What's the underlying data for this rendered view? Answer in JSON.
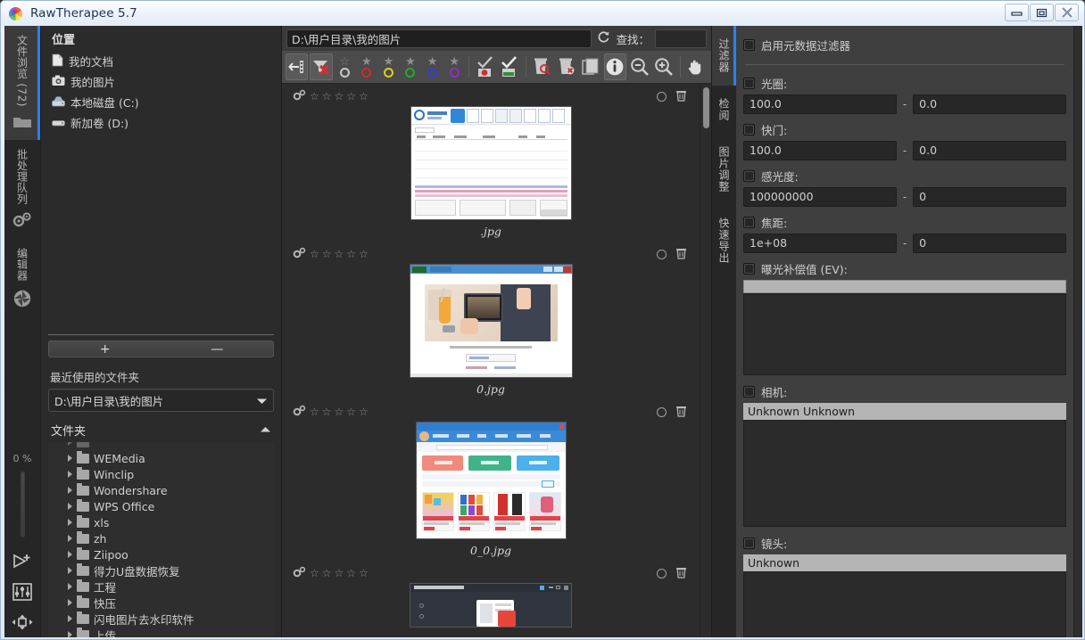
{
  "window": {
    "title": "RawTherapee 5.7",
    "logo_icon": "rawtherapee-color-wheel-icon",
    "buttons": {
      "minimize": "minimize-icon",
      "maximize": "restore-icon",
      "close": "close-icon"
    }
  },
  "left_tabs": [
    {
      "label": "文件浏览 (72)",
      "icon": "folder-icon",
      "active": true
    },
    {
      "label": "批处理队列",
      "icon": "gears-icon",
      "active": false
    },
    {
      "label": "编辑器",
      "icon": "aperture-icon",
      "active": false
    }
  ],
  "left_bottom": {
    "progress_percent": "0 %",
    "icons": [
      "send-to-editor-icon",
      "sliders-icon",
      "move-resize-icon"
    ]
  },
  "places": {
    "title": "位置",
    "items": [
      {
        "label": "我的文档",
        "icon": "document-icon"
      },
      {
        "label": "我的图片",
        "icon": "camera-icon"
      },
      {
        "label": "本地磁盘 (C:)",
        "icon": "hard-disk-icon"
      },
      {
        "label": "新加卷 (D:)",
        "icon": "drive-icon"
      }
    ],
    "add_label": "+",
    "remove_label": "—"
  },
  "recent": {
    "label": "最近使用的文件夹",
    "value": "D:\\用户目录\\我的图片",
    "dropdown_icon": "chevron-down-icon"
  },
  "folders": {
    "label": "文件夹",
    "collapse_icon": "chevron-up-icon",
    "items": [
      "WEMedia",
      "Winclip",
      "Wondershare",
      "WPS Office",
      "xls",
      "zh",
      "Ziipoo",
      "得力U盘数据恢复",
      "工程",
      "快压",
      "闪电图片去水印软件",
      "上传"
    ]
  },
  "browser": {
    "path": "D:\\用户目录\\我的图片",
    "refresh_icon": "refresh-icon",
    "find_label": "查找：",
    "find_value": "",
    "toolbar": [
      {
        "name": "open-previous-icon",
        "framed": true
      },
      {
        "name": "clear-filters-icon",
        "framed": true
      },
      {
        "name": "rating-0-icon",
        "framed": false
      },
      {
        "name": "rating-1-icon",
        "framed": false
      },
      {
        "name": "rating-2-icon",
        "framed": false
      },
      {
        "name": "rating-3-icon",
        "framed": false
      },
      {
        "name": "rating-4-icon",
        "framed": false
      },
      {
        "name": "rating-5-icon",
        "framed": false
      },
      {
        "name": "unedited-filter-icon",
        "framed": false
      },
      {
        "name": "edited-filter-icon",
        "framed": false
      },
      {
        "name": "trash-show-icon",
        "framed": false
      },
      {
        "name": "trash-empty-icon",
        "framed": false
      },
      {
        "name": "copy-profile-icon",
        "framed": false
      },
      {
        "name": "info-icon",
        "framed": true
      },
      {
        "name": "zoom-out-icon",
        "framed": false
      },
      {
        "name": "zoom-in-icon",
        "framed": false
      },
      {
        "name": "pan-hand-icon",
        "framed": false
      }
    ],
    "rating_colors": [
      "#b9b9b9",
      "#d02a2a",
      "#d8cf22",
      "#27a82c",
      "#2f3fd0",
      "#8f2fbf"
    ],
    "thumbnails": [
      {
        "caption": ".jpg",
        "kind": "spreadsheet-screenshot",
        "stars": 5,
        "gear_icon": "processing-profile-icon",
        "ring_icon": "color-label-icon",
        "trash_icon": "trash-icon"
      },
      {
        "caption": "0.jpg",
        "kind": "photo-tablet-screenshot",
        "stars": 5,
        "gear_icon": "processing-profile-icon",
        "ring_icon": "color-label-icon",
        "trash_icon": "trash-icon"
      },
      {
        "caption": "0_0.jpg",
        "kind": "shopping-page-screenshot",
        "stars": 5,
        "gear_icon": "processing-profile-icon",
        "ring_icon": "color-label-icon",
        "trash_icon": "trash-icon"
      },
      {
        "caption": "",
        "kind": "dark-app-screenshot",
        "stars": 5,
        "gear_icon": "processing-profile-icon",
        "ring_icon": "color-label-icon",
        "trash_icon": "trash-icon"
      }
    ]
  },
  "right_tabs": [
    {
      "label": "过滤器",
      "active": true
    },
    {
      "label": "检阅",
      "active": false
    },
    {
      "label": "图片调整",
      "active": false
    },
    {
      "label": "快速导出",
      "active": false
    }
  ],
  "filters": {
    "enable_metadata_filter": "启用元数据过滤器",
    "aperture": {
      "label": "光圈:",
      "from": "100.0",
      "to": "0.0"
    },
    "shutter": {
      "label": "快门:",
      "from": "100.0",
      "to": "0.0"
    },
    "iso": {
      "label": "感光度:",
      "from": "100000000",
      "to": "0"
    },
    "focal": {
      "label": "焦距:",
      "from": "1e+08",
      "to": "0"
    },
    "exposure": {
      "label": "曝光补偿值 (EV):"
    },
    "camera": {
      "label": "相机:",
      "selected": "Unknown Unknown"
    },
    "lens": {
      "label": "镜头:",
      "selected": "Unknown"
    },
    "separator": "-"
  }
}
